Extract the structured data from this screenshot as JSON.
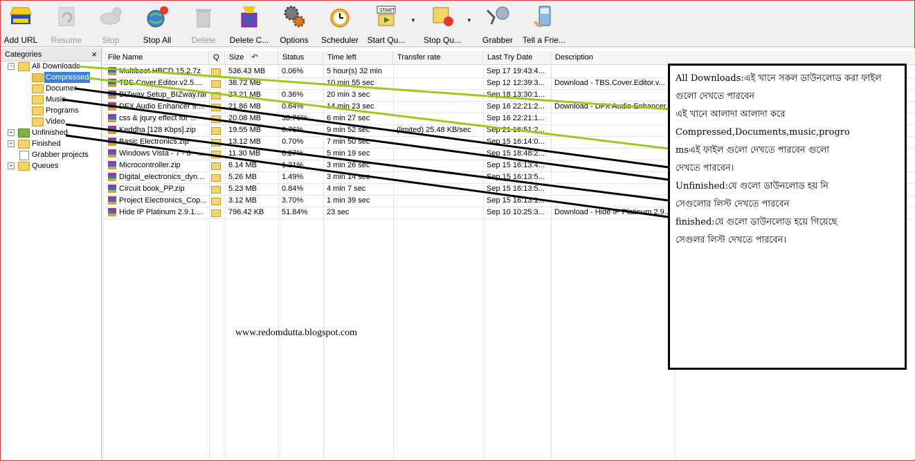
{
  "toolbar": {
    "buttons": [
      {
        "label": "Add URL",
        "enabled": true
      },
      {
        "label": "Resume",
        "enabled": false
      },
      {
        "label": "Stop",
        "enabled": false
      },
      {
        "label": "Stop All",
        "enabled": true
      },
      {
        "label": "Delete",
        "enabled": false
      },
      {
        "label": "Delete C...",
        "enabled": true
      },
      {
        "label": "Options",
        "enabled": true
      },
      {
        "label": "Scheduler",
        "enabled": true
      },
      {
        "label": "Start Qu...",
        "enabled": true
      },
      {
        "label": "Stop Qu...",
        "enabled": true
      },
      {
        "label": "Grabber",
        "enabled": true
      },
      {
        "label": "Tell a Frie...",
        "enabled": true
      }
    ]
  },
  "sidebar": {
    "title": "Categories",
    "close_glyph": "×",
    "items": [
      {
        "label": "All Downloads"
      },
      {
        "label": "Compressed"
      },
      {
        "label": "Documents"
      },
      {
        "label": "Music"
      },
      {
        "label": "Programs"
      },
      {
        "label": "Video"
      },
      {
        "label": "Unfinished"
      },
      {
        "label": "Finished"
      },
      {
        "label": "Grabber projects"
      },
      {
        "label": "Queues"
      }
    ]
  },
  "table": {
    "columns": [
      "File Name",
      "Q",
      "Size",
      "Status",
      "Time left",
      "Transfer rate",
      "Last Try Date",
      "Description"
    ],
    "rows": [
      {
        "name": "Multiboot HBCD 15.2.7z",
        "size": "536.43  MB",
        "status": "0.06%",
        "time": "5 hour(s) 32 min",
        "rate": "",
        "date": "Sep 17 19:43:4...",
        "desc": ""
      },
      {
        "name": "TBS.Cover.Editor.v2.5....",
        "size": "38.72  MB",
        "status": "",
        "time": "10 min 55 sec",
        "rate": "",
        "date": "Sep 12 12:39:3...",
        "desc": "Download - TBS.Cover.Editor.v..."
      },
      {
        "name": "BIZway Setup_BIZway.rar",
        "size": "23.21  MB",
        "status": "0.36%",
        "time": "20 min 3 sec",
        "rate": "",
        "date": "Sep 18 13:30:1...",
        "desc": ""
      },
      {
        "name": "DFX Audio Enhancer 9....",
        "size": "21.86  MB",
        "status": "0.64%",
        "time": "14 min 23 sec",
        "rate": "",
        "date": "Sep 16 22:21:2...",
        "desc": "Download - DFX Audio Enhancer..."
      },
      {
        "name": "css & jqury effect for ...",
        "size": "20.08  MB",
        "status": "38.76%",
        "time": "6 min 27 sec",
        "rate": "",
        "date": "Sep 16 22:21:1...",
        "desc": ""
      },
      {
        "name": "Keddha [128 Kbps].zip",
        "size": "19.55  MB",
        "status": "6.76%",
        "time": "9 min 52 sec",
        "rate": "(limited) 25.48  KB/sec",
        "date": "Sep 21 16:51:2...",
        "desc": ""
      },
      {
        "name": "Basic Electronics.zip",
        "size": "13.12  MB",
        "status": "0.70%",
        "time": "7 min 50 sec",
        "rate": "",
        "date": "Sep 15 16:14:0...",
        "desc": ""
      },
      {
        "name": "Windows Vista - 7 - 8 - ...",
        "size": "11.30  MB",
        "status": "8.27%",
        "time": "5 min 19 sec",
        "rate": "",
        "date": "Sep 15 18:48:2...",
        "desc": ""
      },
      {
        "name": "Microcontroller.zip",
        "size": "6.14  MB",
        "status": "1.21%",
        "time": "3 min 26 sec",
        "rate": "",
        "date": "Sep 15 16:13:4...",
        "desc": ""
      },
      {
        "name": "Digital_electronics_dyn...",
        "size": "5.26  MB",
        "status": "1.49%",
        "time": "3 min 14 sec",
        "rate": "",
        "date": "Sep 15 16:13:5...",
        "desc": ""
      },
      {
        "name": "Circuit book_PP.zip",
        "size": "5.23  MB",
        "status": "0.84%",
        "time": "4 min 7 sec",
        "rate": "",
        "date": "Sep 15 16:13:5...",
        "desc": ""
      },
      {
        "name": "Project Electronics_Cop...",
        "size": "3.12  MB",
        "status": "3.70%",
        "time": "1 min 39 sec",
        "rate": "",
        "date": "Sep 15 16:13:1...",
        "desc": ""
      },
      {
        "name": "Hide IP Platinum 2.9.1....",
        "size": "796.42  KB",
        "status": "51.84%",
        "time": "23 sec",
        "rate": "",
        "date": "Sep 10 10:25:3...",
        "desc": "Download - Hide IP Platinum 2.9..."
      }
    ]
  },
  "annotation": {
    "lines": [
      "All Downloads:এই খানে সকল ডাউনলোড করা ফাইল",
      "গুলো দেখতে পারবেন",
      "এই খানে আলাদা আলাদা করে",
      "Compressed,Documents,music,progro",
      "msএই ফাইল গুলো দেখতে পারবেন গুলো",
      "দেখতে পারবেন।",
      "Unfinished:যে গুলো ডাউনলোড হয় নি",
      "সেগুলোর লিস্ট দেখতে পারবেন",
      "finished:যে গুলো ডাউনলোড হয়ে গিয়েছে",
      "সেগুলর লিস্ট দেখতে পারবেন।"
    ],
    "watermark": "www.redomdutta.blogspot.com",
    "colors": {
      "green": "#99cc1a",
      "black": "#000000"
    }
  }
}
